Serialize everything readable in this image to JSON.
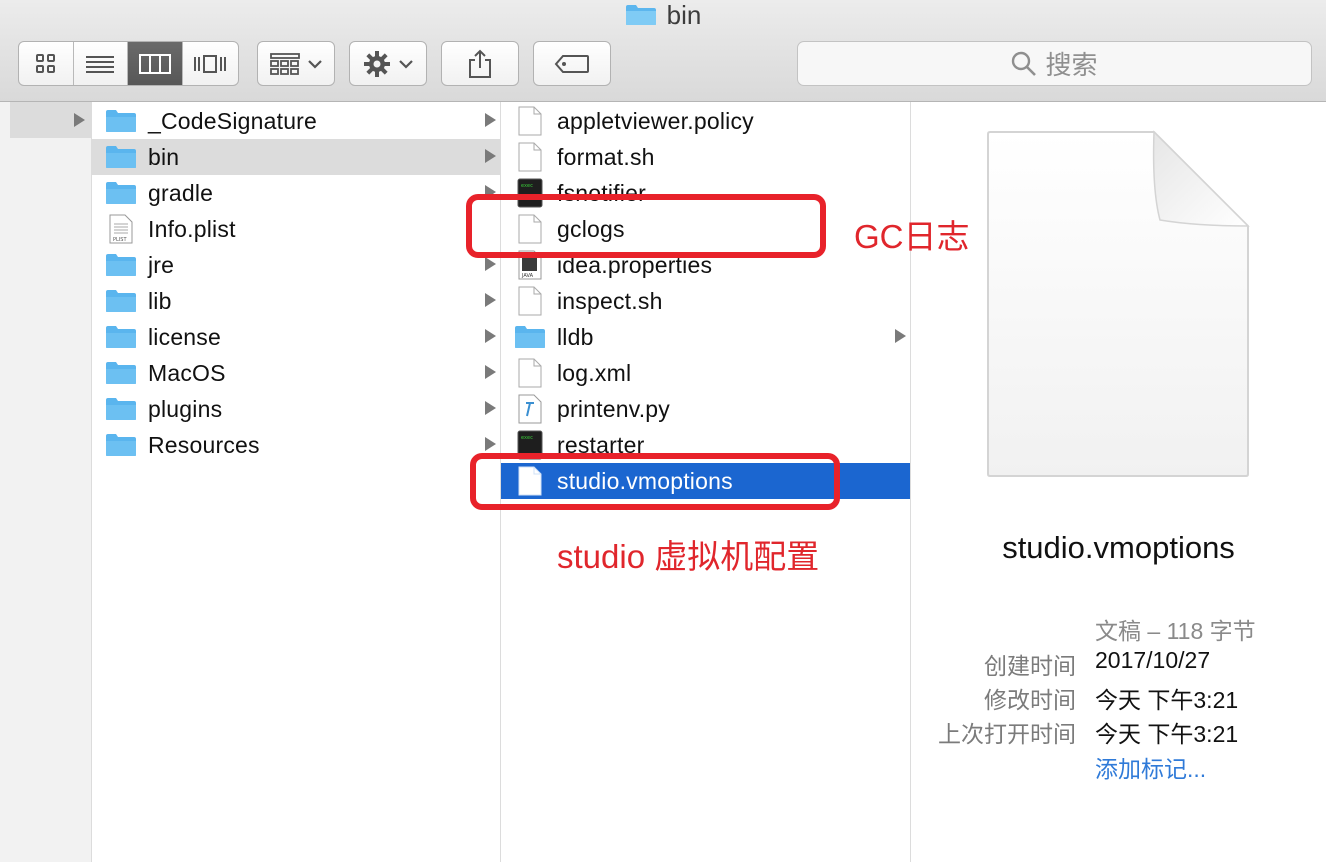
{
  "window": {
    "title": "bin"
  },
  "toolbar": {
    "view_modes": [
      {
        "name": "icon-view",
        "icon": "grid-icon",
        "active": false
      },
      {
        "name": "list-view",
        "icon": "list-icon",
        "active": false
      },
      {
        "name": "column-view",
        "icon": "columns-icon",
        "active": true
      },
      {
        "name": "cover-flow-view",
        "icon": "coverflow-icon",
        "active": false
      }
    ],
    "search_placeholder": "搜索"
  },
  "column1": [
    {
      "name": "_CodeSignature",
      "type": "folder",
      "has_children": true
    },
    {
      "name": "bin",
      "type": "folder",
      "has_children": true,
      "selected": true
    },
    {
      "name": "gradle",
      "type": "folder",
      "has_children": true
    },
    {
      "name": "Info.plist",
      "type": "plist",
      "has_children": false
    },
    {
      "name": "jre",
      "type": "folder",
      "has_children": true
    },
    {
      "name": "lib",
      "type": "folder",
      "has_children": true
    },
    {
      "name": "license",
      "type": "folder",
      "has_children": true
    },
    {
      "name": "MacOS",
      "type": "folder",
      "has_children": true
    },
    {
      "name": "plugins",
      "type": "folder",
      "has_children": true
    },
    {
      "name": "Resources",
      "type": "folder",
      "has_children": true
    }
  ],
  "column2": [
    {
      "name": "appletviewer.policy",
      "type": "doc",
      "has_children": false
    },
    {
      "name": "format.sh",
      "type": "doc",
      "has_children": false
    },
    {
      "name": "fsnotifier",
      "type": "exec",
      "has_children": false
    },
    {
      "name": "gclogs",
      "type": "doc",
      "has_children": false
    },
    {
      "name": "idea.properties",
      "type": "java",
      "has_children": false
    },
    {
      "name": "inspect.sh",
      "type": "doc",
      "has_children": false
    },
    {
      "name": "lldb",
      "type": "folder",
      "has_children": true
    },
    {
      "name": "log.xml",
      "type": "doc",
      "has_children": false
    },
    {
      "name": "printenv.py",
      "type": "py",
      "has_children": false
    },
    {
      "name": "restarter",
      "type": "exec",
      "has_children": false
    },
    {
      "name": "studio.vmoptions",
      "type": "doc",
      "has_children": false,
      "selected": true
    }
  ],
  "preview": {
    "filename": "studio.vmoptions",
    "kind_size": "文稿 – 118 字节",
    "created_label": "创建时间",
    "created_value": "2017/10/27",
    "modified_label": "修改时间",
    "modified_value": "今天 下午3:21",
    "opened_label": "上次打开时间",
    "opened_value": "今天 下午3:21",
    "add_tags": "添加标记..."
  },
  "annotations": {
    "gclogs": "GC日志",
    "vmoptions": "studio 虚拟机配置"
  },
  "colors": {
    "selection": "#1b66d0",
    "folder": "#6cc0f2",
    "annotation": "#e8222a"
  }
}
